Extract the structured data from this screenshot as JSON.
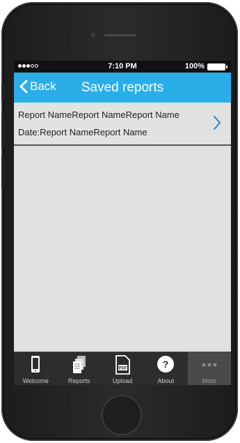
{
  "status_bar": {
    "time": "7:10 PM",
    "battery": "100%"
  },
  "nav": {
    "back_label": "Back",
    "title": "Saved reports"
  },
  "report": {
    "name": "Report NameReport NameReport Name",
    "date": "Date:Report NameReport Name"
  },
  "tabs": [
    {
      "label": "Welcome",
      "icon": "phone-icon"
    },
    {
      "label": "Reports",
      "icon": "documents-icon"
    },
    {
      "label": "Upload",
      "icon": "pdf-icon"
    },
    {
      "label": "About",
      "icon": "question-icon"
    },
    {
      "label": "More",
      "icon": "more-dots-icon"
    }
  ],
  "colors": {
    "accent": "#2aaee8",
    "tabbar": "#2d2d2d",
    "screen_bg": "#e0e0e0"
  }
}
